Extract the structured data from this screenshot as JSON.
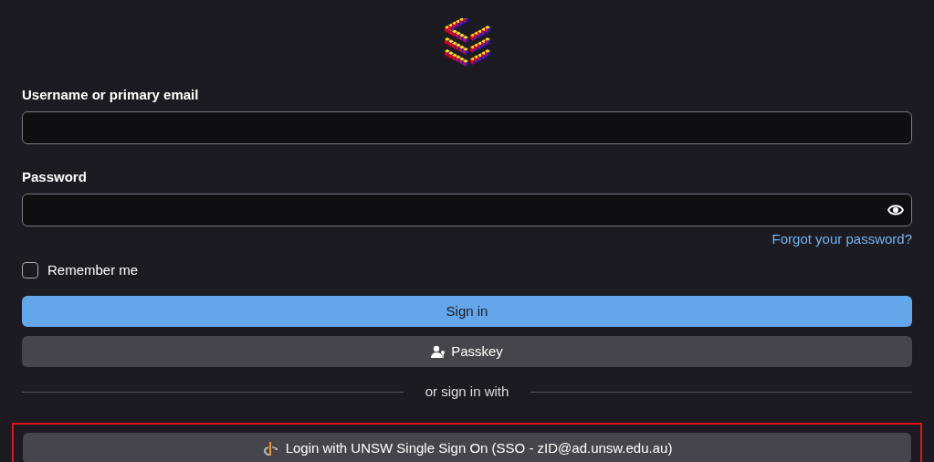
{
  "form": {
    "username_label": "Username or primary email",
    "password_label": "Password",
    "forgot_link": "Forgot your password?",
    "remember": {
      "label": "Remember me",
      "checked": false
    }
  },
  "buttons": [
    {
      "kind": "primary",
      "label": "Sign in"
    },
    {
      "kind": "passkey",
      "label": "Passkey"
    }
  ],
  "divider": "or sign in with",
  "sso": {
    "label": "Login with UNSW Single Sign On (SSO - zID@ad.unsw.edu.au)",
    "highlighted": true
  }
}
